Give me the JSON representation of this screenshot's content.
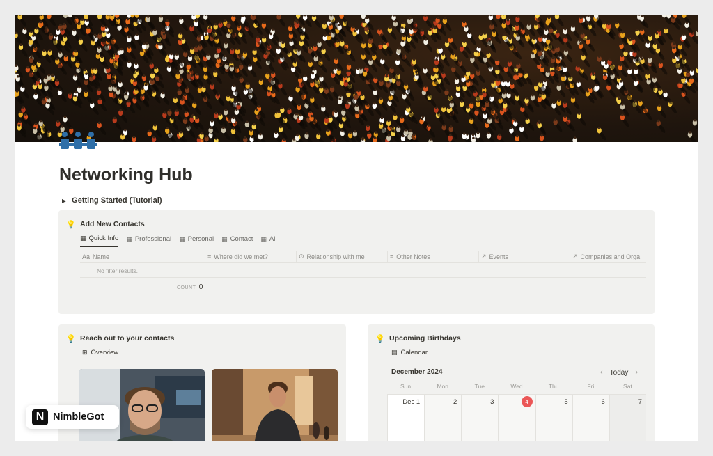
{
  "page": {
    "title": "Networking Hub",
    "cover_alt": "crowd-cover",
    "toggle_label": "Getting Started (Tutorial)"
  },
  "add_contacts": {
    "title": "Add New Contacts",
    "tabs": [
      {
        "label": "Quick Info",
        "active": true
      },
      {
        "label": "Professional",
        "active": false
      },
      {
        "label": "Personal",
        "active": false
      },
      {
        "label": "Contact",
        "active": false
      },
      {
        "label": "All",
        "active": false
      }
    ],
    "columns": [
      {
        "prefix": "Aa",
        "label": "Name"
      },
      {
        "prefix": "≡",
        "label": "Where did we met?"
      },
      {
        "prefix": "⊙",
        "label": "Relationship with me"
      },
      {
        "prefix": "≡",
        "label": "Other Notes"
      },
      {
        "prefix": "↗",
        "label": "Events"
      },
      {
        "prefix": "↗",
        "label": "Companies and Orga"
      }
    ],
    "empty_text": "No filter results.",
    "count_label": "COUNT",
    "count_value": "0"
  },
  "reach_out": {
    "title": "Reach out to your contacts",
    "view_label": "Overview"
  },
  "birthdays": {
    "title": "Upcoming Birthdays",
    "view_label": "Calendar",
    "month": "December 2024",
    "today_label": "Today",
    "weekdays": [
      "Sun",
      "Mon",
      "Tue",
      "Wed",
      "Thu",
      "Fri",
      "Sat"
    ],
    "dates": [
      "Dec 1",
      "2",
      "3",
      "4",
      "5",
      "6",
      "7"
    ],
    "today_index": 3
  },
  "brand": {
    "logo_letter": "N",
    "name": "NimbleGot"
  },
  "colors": {
    "accent_today": "#eb5757",
    "callout_bg": "#f1f1ef",
    "icon_blue": "#2f6fa8"
  }
}
